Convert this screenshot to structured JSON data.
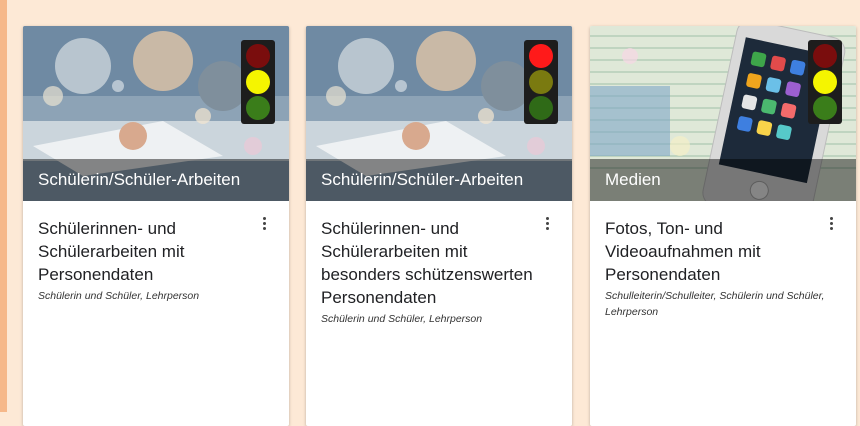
{
  "cards": [
    {
      "caption": "Schülerin/Schüler-Arbeiten",
      "title": "Schülerinnen- und Schülerarbeiten mit Personendaten",
      "subtitle": "Schülerin und Schüler, Lehrperson",
      "traffic_light": {
        "red": "#7a0d0d",
        "yellow": "#f5f500",
        "green": "#3a7d1a"
      },
      "menu_icon": "more-vert-icon"
    },
    {
      "caption": "Schülerin/Schüler-Arbeiten",
      "title": "Schülerinnen- und Schülerarbeiten mit besonders schützenswerten Personendaten",
      "subtitle": "Schülerin und Schüler, Lehrperson",
      "traffic_light": {
        "red": "#ff1a1a",
        "yellow": "#7a7a10",
        "green": "#2f6a17"
      },
      "menu_icon": "more-vert-icon"
    },
    {
      "caption": "Medien",
      "title": "Fotos, Ton- und Videoaufnahmen mit Personendaten",
      "subtitle": "Schulleiterin/Schulleiter, Schülerin und Schüler, Lehrperson",
      "traffic_light": {
        "red": "#7a0d0d",
        "yellow": "#f5f500",
        "green": "#3a7d1a"
      },
      "menu_icon": "more-vert-icon"
    }
  ],
  "colors": {
    "background": "#fde9d6",
    "accent_edge": "#f6b88a"
  }
}
